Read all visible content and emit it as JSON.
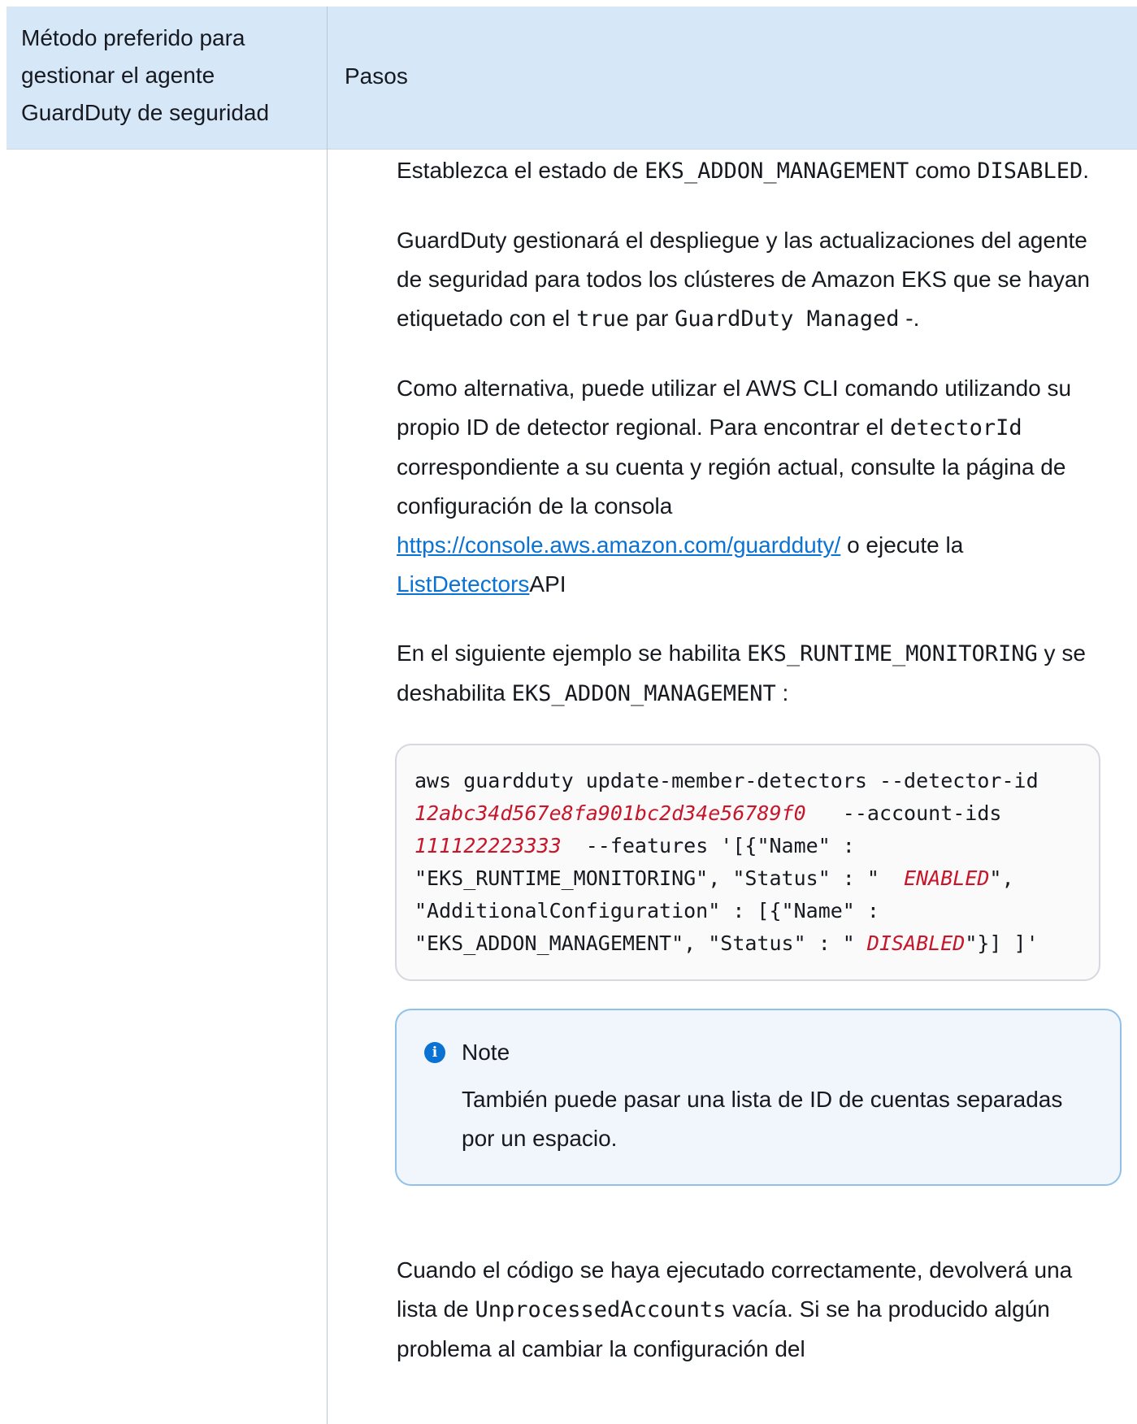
{
  "table": {
    "header_col1": "Método preferido para gestionar el agente GuardDuty de seguridad",
    "header_col2": "Pasos"
  },
  "p1": {
    "t1": "Establezca el estado de ",
    "c1": "EKS_ADDON_MANAGEMENT",
    "t2": " como ",
    "c2": "DISABLED",
    "t3": "."
  },
  "p2": {
    "t1": "GuardDuty gestionará el despliegue y las actualizaciones del agente de seguridad para todos los clústeres de Amazon EKS que se hayan etiquetado con el ",
    "c1": "true",
    "t2": " par ",
    "c2": "GuardDuty Managed",
    "t3": " -."
  },
  "p3": {
    "t1": "Como alternativa, puede utilizar el AWS CLI comando utilizando su propio ID de detector regional. Para encontrar el ",
    "c1": "detectorId",
    "t2": " correspondiente a su cuenta y región actual, consulte la página de configuración de la consola ",
    "link1": "https://console.aws.amazon.com/guardduty/",
    "t3": " o ejecute la ",
    "link2": "ListDetectors",
    "t4": "API"
  },
  "p4": {
    "t1": "En el siguiente ejemplo se habilita ",
    "c1": "EKS_RUNTIME_MONITORING",
    "t2": " y se deshabilita ",
    "c2": "EKS_ADDON_MANAGEMENT",
    "t3": " :"
  },
  "code": {
    "s1": "aws guardduty update-member-detectors --detector-id ",
    "v1": "12abc34d567e8fa901bc2d34e56789f0",
    "s2": "   --account-ids ",
    "v2": "111122223333",
    "s3": "  --features '[{\"Name\" : \"EKS_RUNTIME_MONITORING\", \"Status\" : \"  ",
    "v3": "ENABLED",
    "s4": "\", \"AdditionalConfiguration\" : [{\"Name\" : \"EKS_ADDON_MANAGEMENT\", \"Status\" : \" ",
    "v4": "DISABLED",
    "s5": "\"}] ]'"
  },
  "note": {
    "icon": "info-icon",
    "title": "Note",
    "body": "También puede pasar una lista de ID de cuentas separadas por un espacio."
  },
  "p5": {
    "t1": "Cuando el código se haya ejecutado correctamente, devolverá una lista de ",
    "c1": "UnprocessedAccounts",
    "t2": " vacía. Si se ha producido algún problema al cambiar la configuración del"
  },
  "colors": {
    "header_bg": "#d6e7f8",
    "link": "#0972d3",
    "code_placeholder": "#c7162b",
    "note_border": "#8fc1e9"
  }
}
